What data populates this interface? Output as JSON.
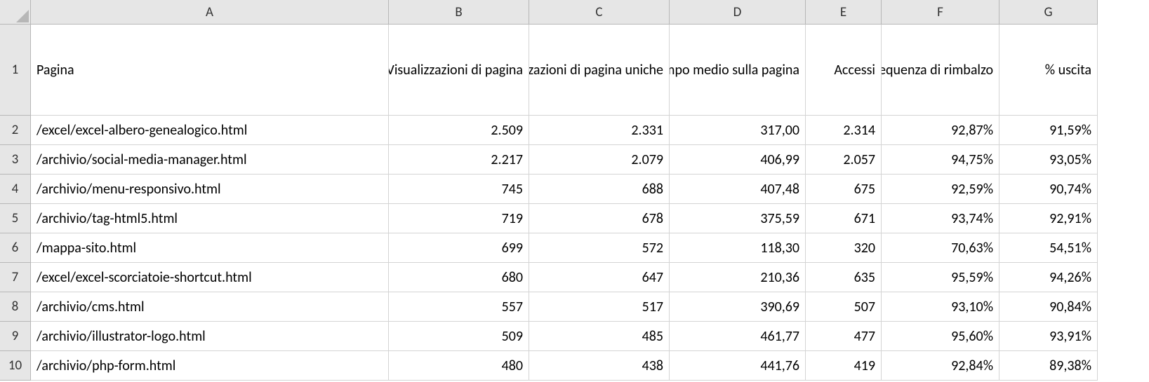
{
  "columns": [
    "A",
    "B",
    "C",
    "D",
    "E",
    "F",
    "G"
  ],
  "headers": {
    "A": "Pagina",
    "B": "Visualizzazioni di pagina",
    "C": "Visualizzazioni di pagina uniche",
    "D": "Tempo medio sulla pagina",
    "E": "Accessi",
    "F": "Frequenza di rimbalzo",
    "G": "% uscita"
  },
  "rows": [
    {
      "n": 2,
      "A": "/excel/excel-albero-genealogico.html",
      "B": "2.509",
      "C": "2.331",
      "D": "317,00",
      "E": "2.314",
      "F": "92,87%",
      "G": "91,59%"
    },
    {
      "n": 3,
      "A": "/archivio/social-media-manager.html",
      "B": "2.217",
      "C": "2.079",
      "D": "406,99",
      "E": "2.057",
      "F": "94,75%",
      "G": "93,05%"
    },
    {
      "n": 4,
      "A": "/archivio/menu-responsivo.html",
      "B": "745",
      "C": "688",
      "D": "407,48",
      "E": "675",
      "F": "92,59%",
      "G": "90,74%"
    },
    {
      "n": 5,
      "A": "/archivio/tag-html5.html",
      "B": "719",
      "C": "678",
      "D": "375,59",
      "E": "671",
      "F": "93,74%",
      "G": "92,91%"
    },
    {
      "n": 6,
      "A": "/mappa-sito.html",
      "B": "699",
      "C": "572",
      "D": "118,30",
      "E": "320",
      "F": "70,63%",
      "G": "54,51%"
    },
    {
      "n": 7,
      "A": "/excel/excel-scorciatoie-shortcut.html",
      "B": "680",
      "C": "647",
      "D": "210,36",
      "E": "635",
      "F": "95,59%",
      "G": "94,26%"
    },
    {
      "n": 8,
      "A": "/archivio/cms.html",
      "B": "557",
      "C": "517",
      "D": "390,69",
      "E": "507",
      "F": "93,10%",
      "G": "90,84%"
    },
    {
      "n": 9,
      "A": "/archivio/illustrator-logo.html",
      "B": "509",
      "C": "485",
      "D": "461,77",
      "E": "477",
      "F": "95,60%",
      "G": "93,91%"
    },
    {
      "n": 10,
      "A": "/archivio/php-form.html",
      "B": "480",
      "C": "438",
      "D": "441,76",
      "E": "419",
      "F": "92,84%",
      "G": "89,38%"
    }
  ],
  "chart_data": {
    "type": "table",
    "title": "",
    "columns": [
      "Pagina",
      "Visualizzazioni di pagina",
      "Visualizzazioni di pagina uniche",
      "Tempo medio sulla pagina",
      "Accessi",
      "Frequenza di rimbalzo",
      "% uscita"
    ],
    "data": [
      [
        "/excel/excel-albero-genealogico.html",
        2509,
        2331,
        317.0,
        2314,
        92.87,
        91.59
      ],
      [
        "/archivio/social-media-manager.html",
        2217,
        2079,
        406.99,
        2057,
        94.75,
        93.05
      ],
      [
        "/archivio/menu-responsivo.html",
        745,
        688,
        407.48,
        675,
        92.59,
        90.74
      ],
      [
        "/archivio/tag-html5.html",
        719,
        678,
        375.59,
        671,
        93.74,
        92.91
      ],
      [
        "/mappa-sito.html",
        699,
        572,
        118.3,
        320,
        70.63,
        54.51
      ],
      [
        "/excel/excel-scorciatoie-shortcut.html",
        680,
        647,
        210.36,
        635,
        95.59,
        94.26
      ],
      [
        "/archivio/cms.html",
        557,
        517,
        390.69,
        507,
        93.1,
        90.84
      ],
      [
        "/archivio/illustrator-logo.html",
        509,
        485,
        461.77,
        477,
        95.6,
        93.91
      ],
      [
        "/archivio/php-form.html",
        480,
        438,
        441.76,
        419,
        92.84,
        89.38
      ]
    ]
  }
}
